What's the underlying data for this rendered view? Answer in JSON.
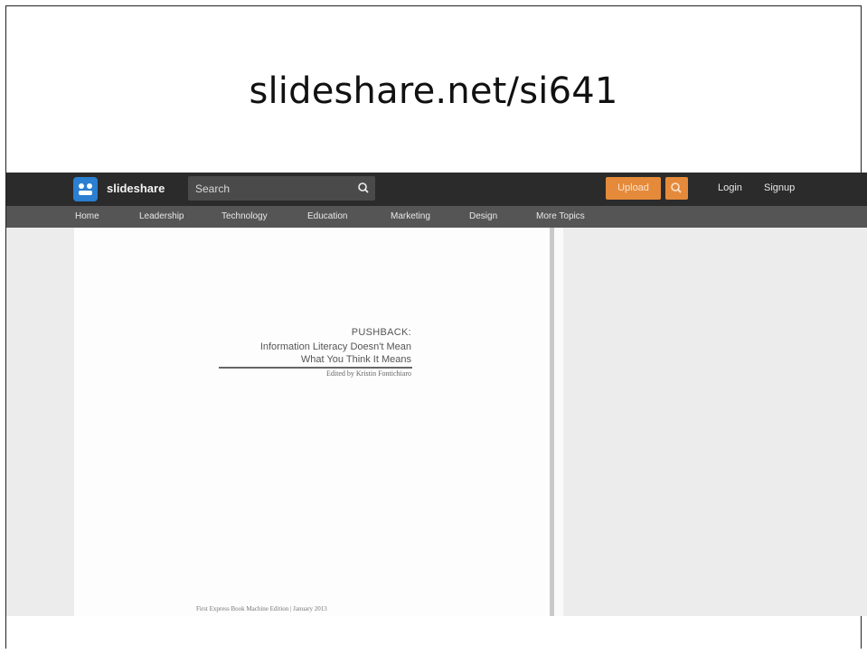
{
  "slide": {
    "title": "slideshare.net/si641"
  },
  "topbar": {
    "brand": "slideshare",
    "search_placeholder": "Search",
    "upload_label": "Upload",
    "login_label": "Login",
    "signup_label": "Signup"
  },
  "nav": {
    "items": [
      "Home",
      "Leadership",
      "Technology",
      "Education",
      "Marketing",
      "Design",
      "More Topics"
    ]
  },
  "document": {
    "title": "PUSHBACK:",
    "subtitle_line1": "Information Literacy Doesn't Mean",
    "subtitle_line2": "What You Think It Means",
    "editor": "Edited by Kristin Fontichiaro",
    "footer": "First Express Book Machine Edition | January 2013"
  },
  "colors": {
    "topbar": "#2b2b2b",
    "navbar": "#555555",
    "accent": "#e58a3a",
    "logo": "#2a7fd1"
  }
}
